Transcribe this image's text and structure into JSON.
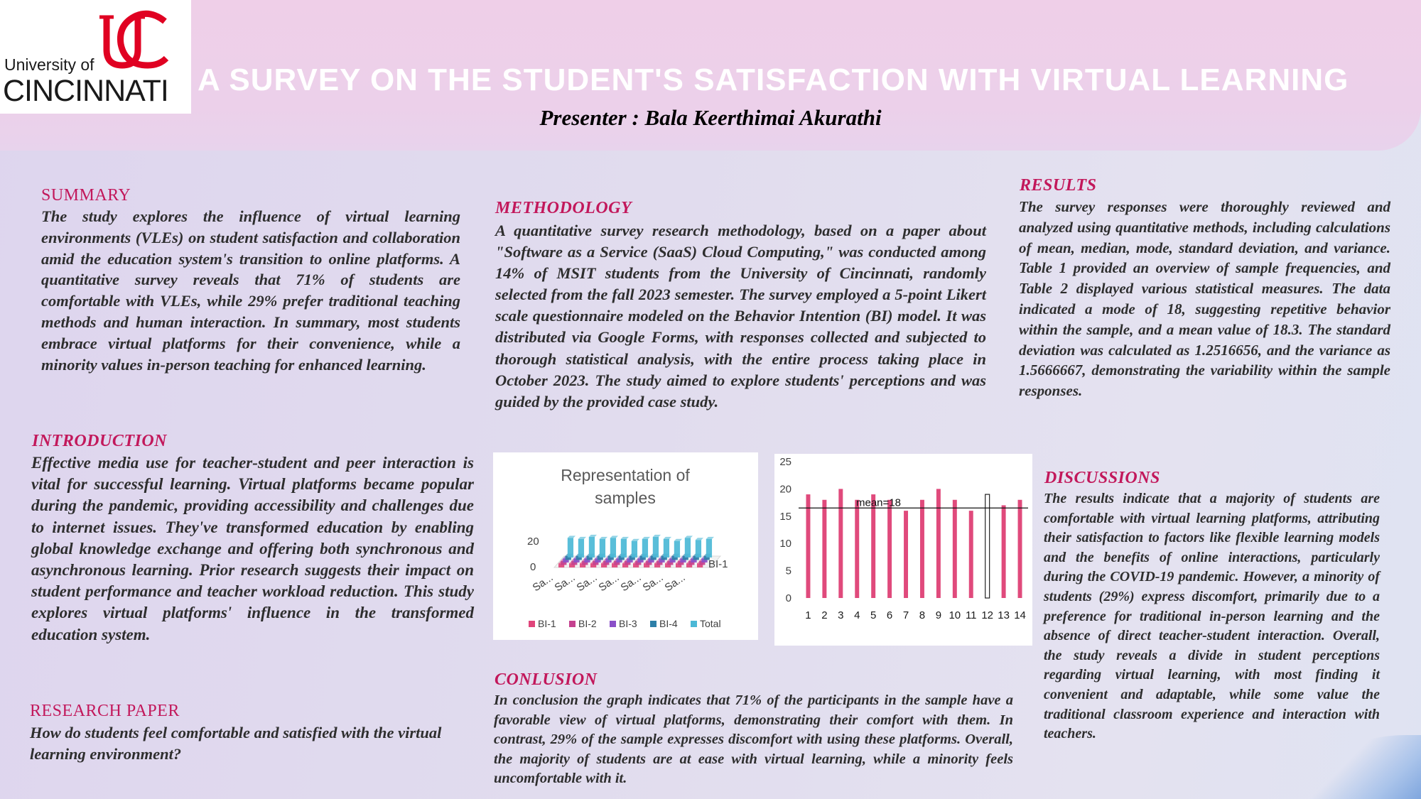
{
  "header": {
    "title": "A SURVEY ON THE STUDENT'S SATISFACTION WITH VIRTUAL LEARNING",
    "presenter": "Presenter : Bala Keerthimai Akurathi",
    "logo_line1": "University of",
    "logo_line2": "CINCINNATI"
  },
  "summary": {
    "heading": "SUMMARY",
    "text": "The study explores the influence of virtual learning environments (VLEs) on student satisfaction and collaboration amid the education system's transition to online platforms. A quantitative survey reveals that 71% of students are comfortable with VLEs, while 29% prefer traditional teaching methods and human interaction. In summary, most students embrace virtual platforms for their convenience, while a minority values in-person teaching for enhanced learning."
  },
  "introduction": {
    "heading": "INTRODUCTION",
    "text": "Effective media use for teacher-student and peer interaction is vital for successful learning. Virtual platforms became popular during the pandemic, providing accessibility and challenges due to internet issues. They've transformed education by enabling global knowledge exchange and offering both synchronous and asynchronous learning. Prior research suggests their impact on student performance and teacher workload reduction. This study explores virtual platforms' influence in the transformed education system."
  },
  "research_paper": {
    "heading": "RESEARCH PAPER",
    "text": "How do students feel comfortable and satisfied with the virtual learning environment?"
  },
  "methodology": {
    "heading": "METHODOLOGY",
    "text": "A quantitative survey research methodology, based on a paper about \"Software as a Service (SaaS) Cloud Computing,\" was conducted among 14% of MSIT students from the University of Cincinnati, randomly selected from the fall 2023 semester. The survey employed a 5-point Likert scale questionnaire modeled on the Behavior Intention (BI) model. It was distributed via Google Forms, with responses collected and subjected to thorough statistical analysis, with the entire process taking place in October 2023. The study aimed to explore students' perceptions and was guided by the provided case study."
  },
  "results": {
    "heading": "RESULTS",
    "text": "The survey responses were thoroughly reviewed and analyzed using quantitative methods, including calculations of mean, median, mode, standard deviation, and variance. Table 1 provided an overview of sample frequencies, and Table 2 displayed various statistical measures. The data indicated a mode of 18, suggesting repetitive behavior within the sample, and a mean value of 18.3. The standard deviation was calculated as 1.2516656, and the variance as 1.5666667, demonstrating the variability within the sample responses."
  },
  "discussions": {
    "heading": "DISCUSSIONS",
    "text": "The results indicate that a majority of students are comfortable with virtual learning platforms, attributing their satisfaction to factors like flexible learning models and the benefits of online interactions, particularly during the COVID-19 pandemic. However, a minority of students (29%) express discomfort, primarily due to a preference for traditional in-person learning and the absence of direct teacher-student interaction. Overall, the study reveals a divide in student perceptions regarding virtual learning, with most finding it convenient and adaptable, while some value the traditional classroom experience and interaction with teachers."
  },
  "conclusion": {
    "heading": "CONLUSION",
    "text": "In conclusion the graph indicates that 71% of the participants in the sample have a favorable view of virtual platforms, demonstrating their comfort with them. In contrast, 29% of the sample expresses discomfort with using these platforms. Overall, the majority of students are at ease with virtual learning, while a minority feels uncomfortable with it."
  },
  "colors": {
    "heading": "#c2185b",
    "bar_pink": "#e04a7c",
    "bi1": "#e0457b",
    "bi2": "#c4418f",
    "bi3": "#8a4fc8",
    "bi4": "#2d7fa8",
    "total": "#4bb8d6"
  },
  "chart_data": [
    {
      "type": "bar",
      "title": "Representation of samples",
      "categories": [
        "Sa...",
        "Sa...",
        "Sa...",
        "Sa...",
        "Sa...",
        "Sa...",
        "Sa..."
      ],
      "ytick_labels": [
        "0",
        "20"
      ],
      "depth_label": "BI-1",
      "series": [
        {
          "name": "BI-1",
          "values": [
            4,
            4,
            4,
            4,
            4,
            4,
            4,
            4,
            4,
            4,
            4,
            4,
            4,
            4
          ]
        },
        {
          "name": "BI-2",
          "values": [
            4,
            4,
            4,
            4,
            4,
            4,
            4,
            4,
            4,
            4,
            4,
            4,
            4,
            4
          ]
        },
        {
          "name": "BI-3",
          "values": [
            4,
            4,
            4,
            4,
            4,
            4,
            4,
            4,
            4,
            4,
            4,
            4,
            4,
            4
          ]
        },
        {
          "name": "BI-4",
          "values": [
            4,
            4,
            4,
            4,
            4,
            4,
            4,
            4,
            4,
            4,
            4,
            4,
            4,
            4
          ]
        },
        {
          "name": "Total",
          "values": [
            19,
            18,
            20,
            18,
            19,
            18,
            16,
            18,
            20,
            18,
            16,
            19,
            17,
            18
          ]
        }
      ],
      "ylim": [
        0,
        25
      ]
    },
    {
      "type": "bar",
      "categories": [
        "1",
        "2",
        "3",
        "4",
        "5",
        "6",
        "7",
        "8",
        "9",
        "10",
        "11",
        "12",
        "13",
        "14"
      ],
      "values": [
        19,
        18,
        20,
        18,
        19,
        18,
        16,
        18,
        20,
        18,
        16,
        19,
        17,
        18
      ],
      "ylim": [
        0,
        25
      ],
      "yticks": [
        0,
        5,
        10,
        15,
        20,
        25
      ],
      "mean_line": 16.5,
      "mean_label": "mean=18",
      "highlighted_index": 11,
      "grid": false
    }
  ]
}
